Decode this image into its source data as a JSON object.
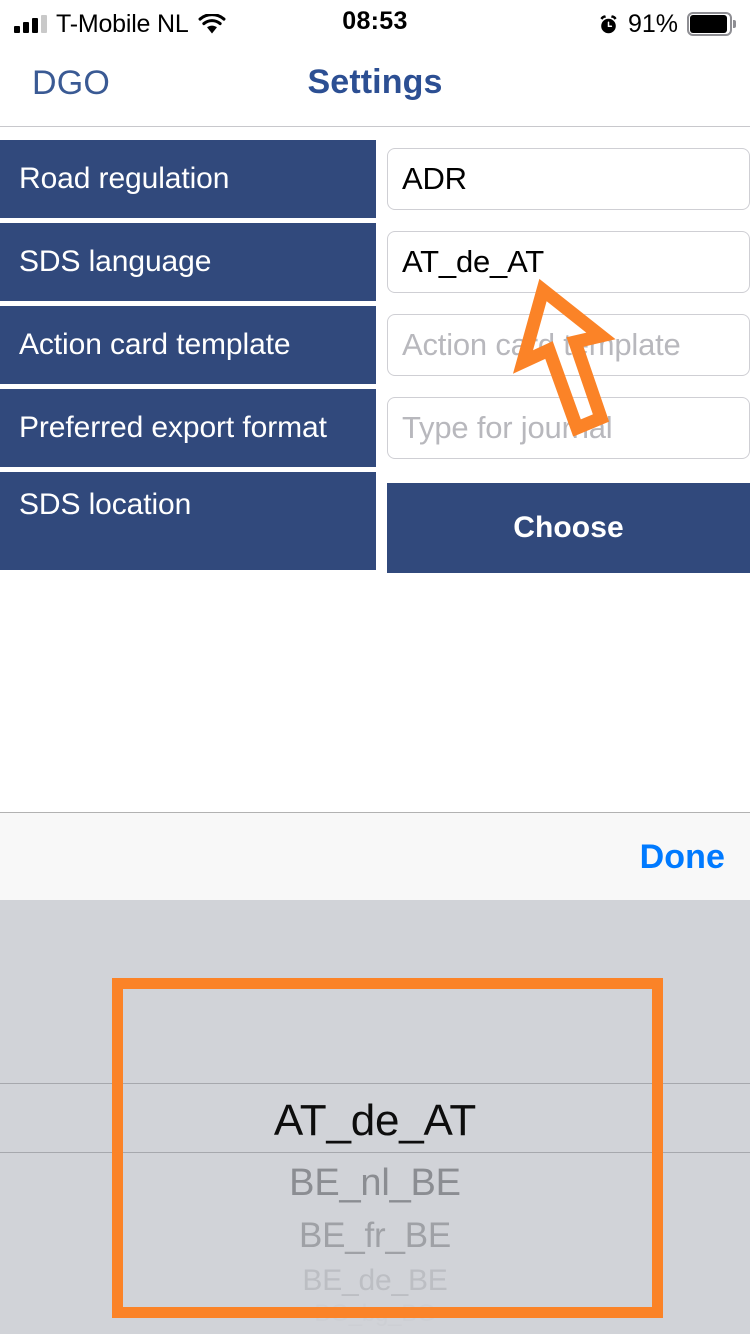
{
  "status_bar": {
    "carrier": "T-Mobile NL",
    "signal_icon": "signal-bars-icon",
    "signal_bars_filled": 3,
    "signal_bars_total": 4,
    "wifi_icon": "wifi-icon",
    "time": "08:53",
    "alarm_icon": "alarm-clock-icon",
    "battery_percent": "91%",
    "battery_icon": "battery-icon"
  },
  "nav_bar": {
    "back_label": "DGO",
    "title": "Settings"
  },
  "settings": {
    "rows": [
      {
        "label": "Road regulation",
        "control": "textfield",
        "value": "ADR",
        "placeholder": ""
      },
      {
        "label": "SDS language",
        "control": "textfield",
        "value": "AT_de_AT",
        "placeholder": ""
      },
      {
        "label": "Action card template",
        "control": "textfield",
        "value": "",
        "placeholder": "Action card template"
      },
      {
        "label": "Preferred export format",
        "control": "textfield",
        "value": "",
        "placeholder": "Type for journal"
      },
      {
        "label": "SDS location",
        "control": "button",
        "value": "Choose",
        "placeholder": ""
      }
    ]
  },
  "picker_toolbar": {
    "done_label": "Done"
  },
  "picker": {
    "selected": "AT_de_AT",
    "items": [
      "AT_de_AT",
      "BE_nl_BE",
      "BE_fr_BE",
      "BE_de_BE",
      "BG_bg_BG"
    ]
  },
  "annotations": {
    "highlight_color": "#fb8327",
    "cursor_icon": "arrow-cursor-icon",
    "highlight_box_name": "picker-highlight-box"
  },
  "colors": {
    "label_cell_blue": "#31497c",
    "nav_title_blue": "#2c4f93",
    "done_blue": "#007aff",
    "picker_background": "#d1d3d8",
    "annotation_orange": "#fb8327"
  }
}
